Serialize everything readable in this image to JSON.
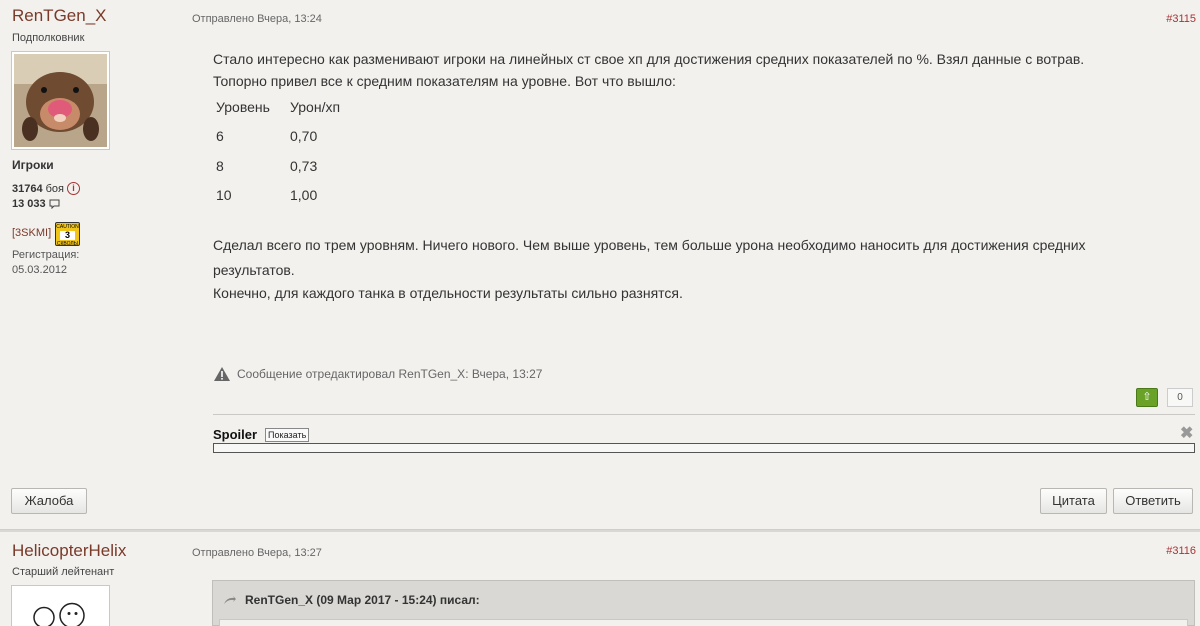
{
  "posts": [
    {
      "author": "RenTGen_X",
      "rank": "Подполковник",
      "group": "Игроки",
      "battles_value": "31764",
      "battles_label": "боя",
      "posts_count": "13  033",
      "clan": "[3SKMI]",
      "badge": {
        "top": "CAUTION",
        "num": "3",
        "bottom": "СКВОЛЫ"
      },
      "registration_label": "Регистрация:",
      "registration_date": "05.03.2012",
      "meta": "Отправлено Вчера, 13:24",
      "post_number": "#3115",
      "paragraph1": "Стало интересно как разменивают игроки на линейных ст свое хп для достижения средних показателей по %. Взял данные с вотрав.",
      "paragraph2": "Топорно привел все к средним показателям на уровне. Вот что вышло:",
      "table": {
        "headers": [
          "Уровень",
          "Урон/хп"
        ],
        "rows": [
          [
            "6",
            "0,70"
          ],
          [
            "8",
            "0,73"
          ],
          [
            "10",
            "1,00"
          ]
        ]
      },
      "paragraph3": "Сделал всего по трем уровням. Ничего нового. Чем выше уровень, тем больше урона необходимо наносить для достижения средних",
      "paragraph3b": "результатов.",
      "paragraph4": "Конечно, для каждого танка в отдельности результаты сильно разнятся.",
      "edited": "Сообщение отредактировал RenTGen_X: Вчера, 13:27",
      "vote_up": "⇧",
      "vote_count": "0",
      "spoiler_title": "Spoiler",
      "spoiler_button": "Показать",
      "close_glyph": "✖",
      "report_button": "Жалоба",
      "quote_button": "Цитата",
      "reply_button": "Ответить"
    },
    {
      "author": "HelicopterHelix",
      "rank": "Старший лейтенант",
      "meta": "Отправлено Вчера, 13:27",
      "post_number": "#3116",
      "quote_header": "RenTGen_X (09 Мар 2017 - 15:24) писал:"
    }
  ],
  "colors": {
    "author": "#7a3a2a",
    "post_number": "#aa3333",
    "vote_up": "#6aa228",
    "background": "#f2f1ee"
  }
}
